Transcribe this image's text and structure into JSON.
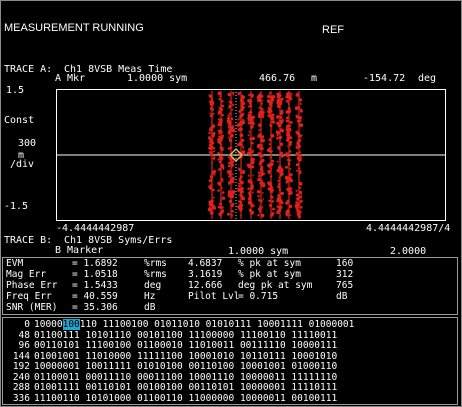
{
  "header": {
    "status": "MEASUREMENT RUNNING",
    "ref": "REF"
  },
  "trace_a": {
    "label": "TRACE A:",
    "title": "Ch1 8VSB Meas Time",
    "marker_label": "A Mkr",
    "marker_x": "1.0000 sym",
    "marker_val": "466.76",
    "marker_unit": "m",
    "marker_phase": "-154.72",
    "marker_phase_unit": "deg",
    "y_top": "1.5",
    "y_const": "Const",
    "y_scale": "300",
    "y_scale_unit": "m",
    "y_div": "/div",
    "y_bottom": "-1.5",
    "x_left": "-4.4444442987",
    "x_right": "4.4444442987/4"
  },
  "trace_b": {
    "label": "TRACE B:",
    "title": "Ch1 8VSB Syms/Errs",
    "marker_label": "B Marker",
    "marker_x": "1.0000 sym",
    "marker_val": "2.0000"
  },
  "errors": {
    "rows": [
      {
        "name": "EVM",
        "val": "= 1.6892",
        "unit": "%rms",
        "pk": "4.6837",
        "pk_text": "% pk at sym",
        "sym": "160"
      },
      {
        "name": "Mag Err",
        "val": "= 1.0518",
        "unit": "%rms",
        "pk": "3.1619",
        "pk_text": "% pk at sym",
        "sym": "312"
      },
      {
        "name": "Phase Err",
        "val": "= 1.5433",
        "unit": "deg",
        "pk": "12.666",
        "pk_text": "deg pk at sym",
        "sym": "765"
      },
      {
        "name": "Freq Err",
        "val": "= 40.559",
        "unit": "Hz",
        "pk": "Pilot Lvl",
        "pk_text": "= 0.715",
        "sym": "dB"
      },
      {
        "name": "SNR (MER)",
        "val": "= 35.306",
        "unit": "dB",
        "pk": "",
        "pk_text": "",
        "sym": ""
      }
    ]
  },
  "symbols": {
    "rows": [
      {
        "index": "0",
        "groups": [
          "10000",
          "110",
          "11100100",
          "01011010",
          "01010111",
          "10001111",
          "01000001"
        ],
        "highlight": "100"
      },
      {
        "index": "48",
        "groups": [
          "01100111",
          "10101110",
          "00101100",
          "11100000",
          "11100110",
          "11110011"
        ]
      },
      {
        "index": "96",
        "groups": [
          "00110101",
          "11100100",
          "01100010",
          "11010011",
          "00111110",
          "10000111"
        ]
      },
      {
        "index": "144",
        "groups": [
          "01001001",
          "11010000",
          "11111100",
          "10001010",
          "10110111",
          "10001010"
        ]
      },
      {
        "index": "192",
        "groups": [
          "10000001",
          "10011111",
          "01010100",
          "00110100",
          "10001001",
          "01000110"
        ]
      },
      {
        "index": "240",
        "groups": [
          "01100011",
          "00011110",
          "00011100",
          "10001110",
          "10000011",
          "11111110"
        ]
      },
      {
        "index": "288",
        "groups": [
          "01001111",
          "00110101",
          "00100100",
          "00110101",
          "10000001",
          "11110111"
        ]
      },
      {
        "index": "336",
        "groups": [
          "11100110",
          "10101000",
          "01100110",
          "11000000",
          "10000011",
          "00100111"
        ]
      }
    ]
  },
  "colors": {
    "trace": "#e0201c",
    "marker": "#e8b44a",
    "grid": "#ffffff",
    "highlight": "#20a4d4"
  }
}
